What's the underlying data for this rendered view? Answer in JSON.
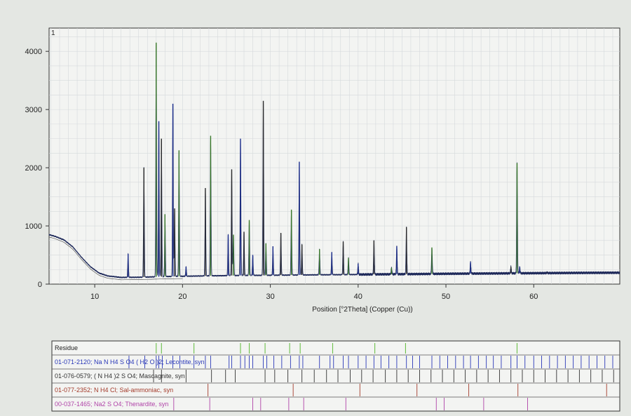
{
  "chart_data": {
    "type": "line",
    "title": "",
    "scan_label": "1",
    "xlabel": "Position [°2Theta] (Copper (Cu))",
    "ylabel": "",
    "xlim": [
      4.8,
      69.8
    ],
    "ylim": [
      0,
      4400
    ],
    "x_ticks": [
      10,
      20,
      30,
      40,
      50,
      60
    ],
    "y_ticks": [
      0,
      1000,
      2000,
      3000,
      4000
    ],
    "grid": true,
    "background_points": [
      [
        4.8,
        850
      ],
      [
        5.5,
        820
      ],
      [
        6.5,
        760
      ],
      [
        7.5,
        640
      ],
      [
        8.5,
        460
      ],
      [
        9.5,
        300
      ],
      [
        10.5,
        190
      ],
      [
        11.5,
        140
      ],
      [
        13,
        115
      ],
      [
        15,
        118
      ],
      [
        18,
        130
      ],
      [
        22,
        140
      ],
      [
        26,
        148
      ],
      [
        30,
        152
      ],
      [
        34,
        158
      ],
      [
        38,
        162
      ],
      [
        42,
        168
      ],
      [
        46,
        172
      ],
      [
        50,
        178
      ],
      [
        54,
        182
      ],
      [
        58,
        186
      ],
      [
        62,
        190
      ],
      [
        66,
        194
      ],
      [
        69.8,
        196
      ]
    ],
    "peaks": [
      [
        13.8,
        520
      ],
      [
        15.6,
        2000
      ],
      [
        17.0,
        4150
      ],
      [
        17.3,
        2800
      ],
      [
        17.6,
        2500
      ],
      [
        18.0,
        1200
      ],
      [
        18.9,
        3100
      ],
      [
        19.1,
        1300
      ],
      [
        19.6,
        2300
      ],
      [
        20.4,
        300
      ],
      [
        22.6,
        1650
      ],
      [
        23.2,
        2550
      ],
      [
        25.2,
        850
      ],
      [
        25.6,
        1970
      ],
      [
        25.8,
        850
      ],
      [
        26.6,
        2500
      ],
      [
        27.0,
        900
      ],
      [
        27.6,
        1100
      ],
      [
        28.0,
        500
      ],
      [
        29.2,
        3150
      ],
      [
        29.5,
        700
      ],
      [
        30.3,
        650
      ],
      [
        31.2,
        880
      ],
      [
        32.4,
        1280
      ],
      [
        33.3,
        2100
      ],
      [
        33.6,
        680
      ],
      [
        35.6,
        600
      ],
      [
        37.0,
        550
      ],
      [
        38.3,
        730
      ],
      [
        38.9,
        450
      ],
      [
        40.0,
        350
      ],
      [
        41.8,
        750
      ],
      [
        43.8,
        280
      ],
      [
        44.4,
        650
      ],
      [
        45.5,
        980
      ],
      [
        48.4,
        630
      ],
      [
        52.8,
        380
      ],
      [
        57.4,
        300
      ],
      [
        58.1,
        2080
      ],
      [
        58.4,
        300
      ],
      [
        61.5,
        200
      ]
    ],
    "residue_label": "Residue",
    "residue_marks": [
      17.0,
      17.6,
      21.3,
      26.6,
      27.6,
      29.4,
      32.2,
      33.4,
      37.1,
      41.9,
      45.4,
      58.1
    ],
    "reference_patterns": [
      {
        "label": "01-071-2120; Na N H4 S O4 ( H2 O )2; Lecontite, syn",
        "color": "#2a38b8",
        "sticks": [
          13.9,
          15.7,
          17.0,
          17.3,
          17.7,
          18.9,
          19.7,
          21.3,
          22.6,
          23.2,
          25.3,
          25.6,
          26.6,
          27.1,
          27.6,
          28.0,
          29.2,
          29.6,
          30.4,
          31.3,
          32.3,
          33.3,
          33.7,
          35.6,
          36.8,
          37.2,
          38.3,
          38.9,
          40.0,
          40.9,
          41.8,
          42.6,
          43.5,
          44.4,
          45.5,
          46.2,
          47.0,
          48.4,
          49.3,
          50.2,
          51.1,
          52.0,
          52.8,
          53.7,
          54.6,
          55.4,
          56.3,
          57.4,
          58.1,
          59.0,
          60.0,
          60.9,
          61.8,
          62.7,
          63.6,
          64.5,
          65.4,
          66.3,
          67.2,
          68.1,
          69.0
        ]
      },
      {
        "label": "01-076-0579; ( N H4 )2 S O4; Mascagnite, syn",
        "color": "#333333",
        "sticks": [
          16.7,
          17.6,
          20.4,
          23.3,
          24.9,
          26.0,
          29.4,
          30.5,
          32.0,
          33.6,
          35.0,
          36.4,
          37.7,
          39.1,
          40.4,
          41.7,
          43.1,
          44.4,
          45.7,
          47.0,
          48.3,
          49.6,
          50.9,
          52.2,
          53.5,
          54.8,
          56.1,
          57.4,
          58.7,
          60.0,
          61.3,
          62.6,
          63.9,
          65.2,
          66.5,
          67.8,
          69.1
        ]
      },
      {
        "label": "01-077-2352; N H4 Cl; Sal-ammoniac, syn",
        "color": "#a33a2a",
        "sticks": [
          22.9,
          32.6,
          40.2,
          46.7,
          52.6,
          58.2,
          68.3
        ]
      },
      {
        "label": "00-037-1465; Na2 S O4; Thenardite, syn",
        "color": "#b043a8",
        "sticks": [
          19.0,
          23.1,
          28.0,
          28.9,
          32.1,
          33.8,
          38.6,
          48.9,
          49.8,
          54.3,
          59.3
        ]
      }
    ]
  }
}
